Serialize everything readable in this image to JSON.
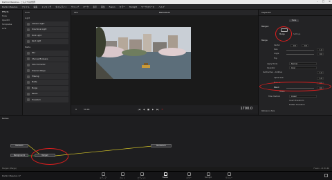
{
  "window": {
    "title": "DaVinci Resolve - こんにちは世界"
  },
  "menubar": {
    "items": [
      "DaVinci Resolve",
      "ファイル",
      "編集",
      "トリミング",
      "タイムライン",
      "クリップ",
      "マーク",
      "表示",
      "再生",
      "Fusion",
      "カラー",
      "Fairlight",
      "ワークスペース",
      "ヘルプ"
    ]
  },
  "effects_panel": {
    "title": "Effects",
    "items": [
      "Tools",
      "OpenFX",
      "Templates",
      "LUTs"
    ]
  },
  "library": {
    "tools_label": "Tools",
    "light_label": "Light",
    "light_items": [
      "Ambient Light",
      "Directional Light",
      "Point Light",
      "Spot Light"
    ],
    "matte_label": "Matte",
    "matte_items": [
      "Blur",
      "Channel Booleans",
      "Color Corrector",
      "Dissolve Merge",
      "Filtering",
      "Matte",
      "Merge",
      "Resize",
      "Transform"
    ]
  },
  "viewer": {
    "clip_name": "MediaOut1",
    "zoom": "68%",
    "fps": "59.94",
    "frame": "0",
    "end_frame": "1700.0",
    "timecode": "1700.0",
    "play_controls": [
      "|◀",
      "◀",
      "■",
      "▶",
      "▶|",
      "⟳"
    ]
  },
  "inspector": {
    "title": "Inspector",
    "tab_tools": "Tools",
    "node_name": "Merge1",
    "tab_merge": "Merge",
    "tab_settings": "Settings",
    "section": "Merge",
    "rows": [
      {
        "label": "Center",
        "x": "0.5",
        "y": "0.5"
      },
      {
        "label": "Size",
        "value": "1.0"
      },
      {
        "label": "Angle",
        "value": "0.0"
      },
      {
        "label": "Flip",
        "value": ""
      },
      {
        "label": "Apply Mode",
        "value": "Normal"
      },
      {
        "label": "Operator",
        "value": "Over"
      },
      {
        "label": "Subtractive - Additive",
        "value": "1.0"
      },
      {
        "label": "Alpha Gain",
        "value": "1.0"
      },
      {
        "label": "Burn In",
        "value": "0.0"
      },
      {
        "label": "Blend",
        "value": "0.0"
      },
      {
        "label": "Invert",
        "value": ""
      },
      {
        "label": "Filter Method",
        "value": "Linear"
      },
      {
        "label": "Invert Transform",
        "value": ""
      },
      {
        "label": "Flatten Transform",
        "value": ""
      }
    ],
    "reference_size": "Reference Size"
  },
  "nodes_panel": {
    "title": "Nodes",
    "nodes": [
      {
        "name": "MediaIn1"
      },
      {
        "name": "Background1"
      },
      {
        "name": "Merge1"
      },
      {
        "name": "MediaOut1"
      }
    ]
  },
  "status": {
    "left": "Merge1 (Merge)",
    "right": "Fusion - 21:51:46"
  },
  "pages": {
    "app": "DaVinci Resolve 17",
    "items": [
      "メディア",
      "カット",
      "エディット",
      "Fusion",
      "カラー",
      "Fairlight",
      "デリバー"
    ]
  },
  "colors": {
    "accent": "#e01e1e",
    "link_yellow": "#d8c828",
    "link_green": "#3fae3f"
  }
}
